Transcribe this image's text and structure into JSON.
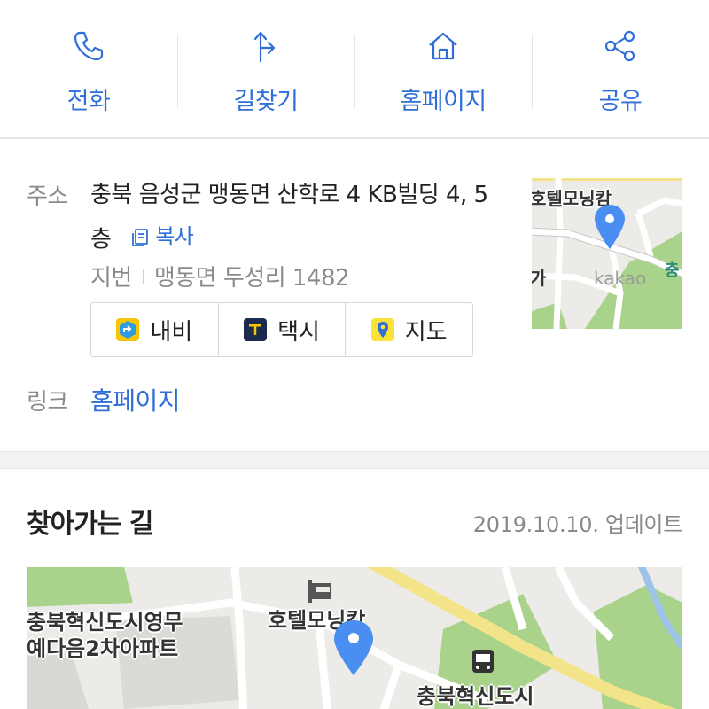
{
  "actions": [
    {
      "label": "전화",
      "icon": "phone-icon"
    },
    {
      "label": "길찾기",
      "icon": "directions-icon"
    },
    {
      "label": "홈페이지",
      "icon": "home-icon"
    },
    {
      "label": "공유",
      "icon": "share-icon"
    }
  ],
  "info": {
    "address_label": "주소",
    "address": "충북 음성군 맹동면 산학로 4 KB빌딩 4, 5층",
    "copy_label": "복사",
    "jibun_label": "지번",
    "jibun_value": "맹동면 두성리 1482",
    "buttons": [
      {
        "label": "내비",
        "icon": "navi-icon",
        "color": "#f7c600"
      },
      {
        "label": "택시",
        "icon": "taxi-icon",
        "color": "#1b2b4d"
      },
      {
        "label": "지도",
        "icon": "map-pin-icon",
        "color": "#fbe236"
      }
    ],
    "link_label": "링크",
    "link_text": "홈페이지"
  },
  "minimap": {
    "place_label": "호텔모닝캄",
    "watermark": "kakao"
  },
  "directions": {
    "title": "찾아가는 길",
    "updated": "2019.10.10. 업데이트"
  },
  "bigmap": {
    "labels": [
      "충북혁신도시영무",
      "예다음2차아파트",
      "호텔모닝캄",
      "충북혁신도시"
    ]
  },
  "colors": {
    "accent": "#2f6ed7",
    "pin": "#4a8ef2",
    "park": "#a9d38b",
    "road_yellow": "#f3e48a"
  }
}
